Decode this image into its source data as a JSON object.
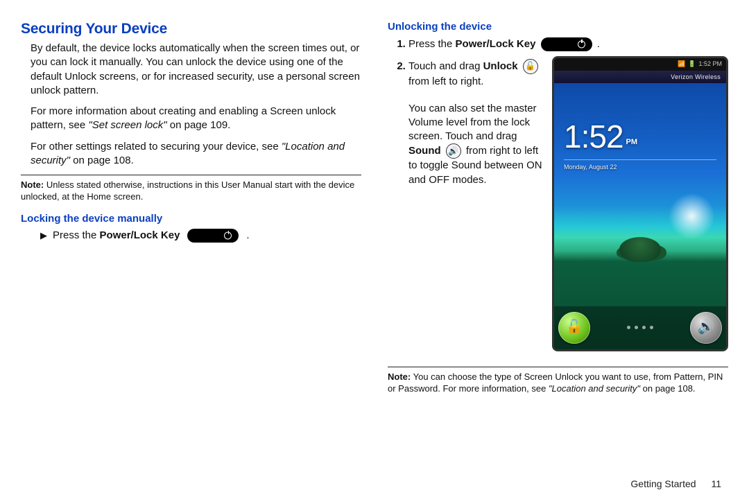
{
  "left": {
    "title": "Securing Your Device",
    "p1": "By default, the device locks automatically when the screen times out, or you can lock it manually. You can unlock the device using one of the default Unlock screens, or for increased security, use a personal screen unlock pattern.",
    "p2a": "For more information about creating and enabling a Screen unlock pattern, see ",
    "p2b": "\"Set screen lock\"",
    "p2c": " on page 109.",
    "p3a": "For other settings related to securing your device, see ",
    "p3b": "\"Location and security\"",
    "p3c": " on page 108.",
    "noteLabel": "Note:",
    "noteBody": "Unless stated otherwise, instructions in this User Manual start with the device unlocked, at the Home screen.",
    "lockingTitle": "Locking the device manually",
    "lockingStepPre": "Press the ",
    "lockingStepBold": "Power/Lock Key",
    "period": " ."
  },
  "right": {
    "unlockingTitle": "Unlocking the device",
    "s1pre": "Press the ",
    "s1bold": "Power/Lock Key",
    "s1post": " .",
    "s2a": "Touch and drag ",
    "s2bold1": "Unlock",
    "s2b": " from left to right.",
    "continuationA": "You can also set the master Volume level from the lock screen.  Touch and drag ",
    "continuationBold": "Sound",
    "continuationB": " from right to left to toggle Sound between ON and OFF modes.",
    "noteLabel": "Note:",
    "noteBodyA": "You can choose the type of Screen Unlock you want to use, from Pattern, PIN or Password. For more information, see ",
    "noteItal": "\"Location and security\"",
    "noteBodyB": " on page 108."
  },
  "phone": {
    "time": "1:52",
    "ampm": "PM",
    "timeSmall": "1:52 PM",
    "date": "Monday, August 22",
    "carrier": "Verizon Wireless"
  },
  "footer": {
    "section": "Getting Started",
    "page": "11"
  }
}
